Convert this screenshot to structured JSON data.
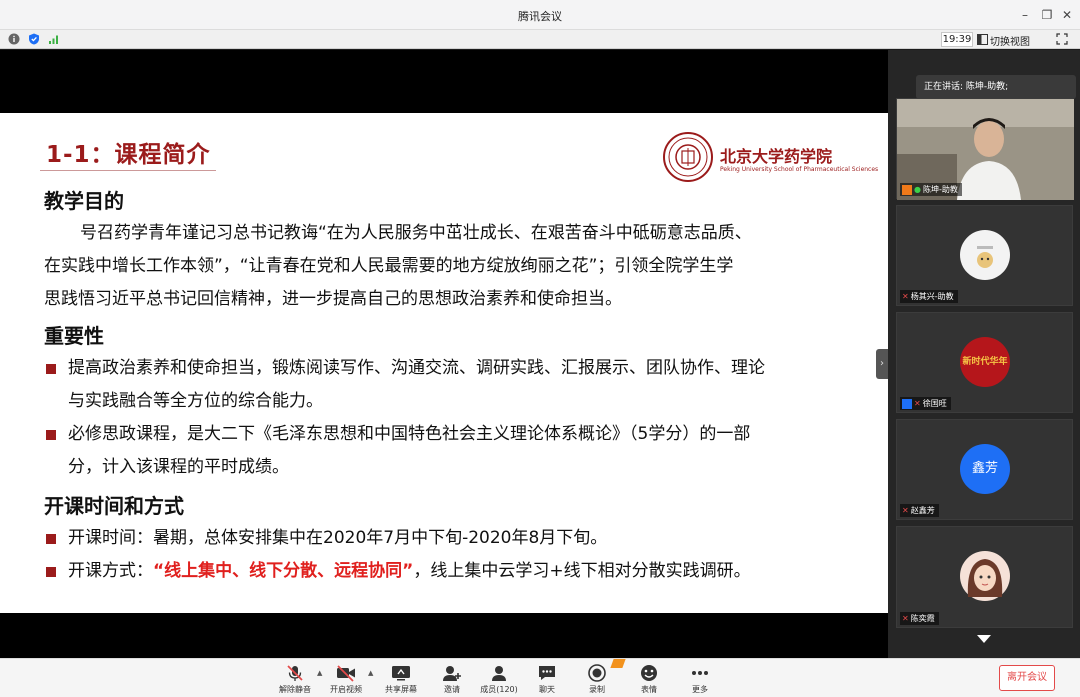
{
  "window": {
    "title": "腾讯会议"
  },
  "statusbar": {
    "time": "19:39",
    "switch_view": "切换视图"
  },
  "slide": {
    "title": "1-1：课程简介",
    "logo_text": "北京大学药学院",
    "logo_sub": "Peking University School of Pharmaceutical Sciences",
    "section1": "教学目的",
    "para1_l1": "号召药学青年谨记习总书记教诲“在为人民服务中茁壮成长、在艰苦奋斗中砥砺意志品质、",
    "para1_l2": "在实践中增长工作本领”，“让青春在党和人民最需要的地方绽放绚丽之花”；引领全院学生学",
    "para1_l3": "思践悟习近平总书记回信精神，进一步提高自己的思想政治素养和使命担当。",
    "section2": "重要性",
    "b1_l1": "提高政治素养和使命担当，锻炼阅读写作、沟通交流、调研实践、汇报展示、团队协作、理论",
    "b1_l2": "与实践融合等全方位的综合能力。",
    "b2_l1": "必修思政课程，是大二下《毛泽东思想和中国特色社会主义理论体系概论》（5学分）的一部",
    "b2_l2": "分，计入该课程的平时成绩。",
    "section3": "开课时间和方式",
    "b3": "开课时间：暑期，总体安排集中在2020年7月中下旬-2020年8月下旬。",
    "b4_prefix": "开课方式：",
    "b4_highlight": "“线上集中、线下分散、远程协同”",
    "b4_suffix": "，线上集中云学习+线下相对分散实践调研。"
  },
  "panel": {
    "speaking": "正在讲话: 陈坤-助教;",
    "participants": [
      {
        "name": "陈坤-助教"
      },
      {
        "name": "杨其兴-助教"
      },
      {
        "name": "徐国旺"
      },
      {
        "name": "赵鑫芳",
        "avatar_text": "鑫芳"
      },
      {
        "name": "陈奕霞"
      }
    ],
    "avatar_caption": "新时代华年"
  },
  "toolbar": {
    "mute": "解除静音",
    "video": "开启视频",
    "share": "共享屏幕",
    "invite": "邀请",
    "members": "成员(120)",
    "chat": "聊天",
    "record": "录制",
    "emoji": "表情",
    "more": "更多",
    "leave": "离开会议"
  },
  "colors": {
    "accent": "#9b1b1b",
    "highlight": "#e0201e",
    "leave": "#e34a4a",
    "avatar_blue": "#1e6ff5"
  }
}
